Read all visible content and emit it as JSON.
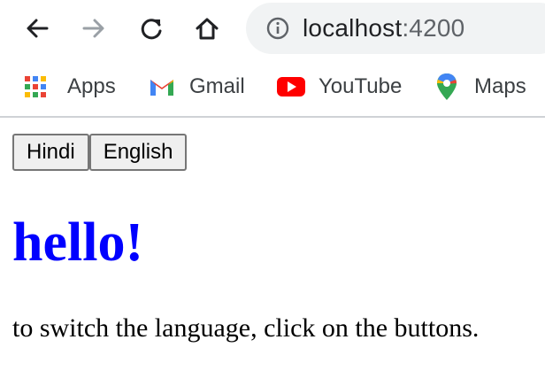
{
  "browser": {
    "url_host": "localhost",
    "url_port": ":4200",
    "icons": {
      "back": "arrow-left-icon",
      "forward": "arrow-right-icon",
      "reload": "reload-icon",
      "home": "home-icon",
      "site_info": "info-icon"
    }
  },
  "bookmarks": [
    {
      "label": "Apps",
      "icon": "apps-grid-icon"
    },
    {
      "label": "Gmail",
      "icon": "gmail-icon"
    },
    {
      "label": "YouTube",
      "icon": "youtube-icon"
    },
    {
      "label": "Maps",
      "icon": "maps-pin-icon"
    }
  ],
  "page": {
    "buttons": [
      "Hindi",
      "English"
    ],
    "heading": "hello!",
    "instruction": "to switch the language, click on the buttons."
  },
  "colors": {
    "heading": "#0000ff",
    "omnibox_bg": "#f1f3f4",
    "youtube": "#ff0000",
    "gmail_red": "#ea4335",
    "maps_green": "#34a853"
  }
}
